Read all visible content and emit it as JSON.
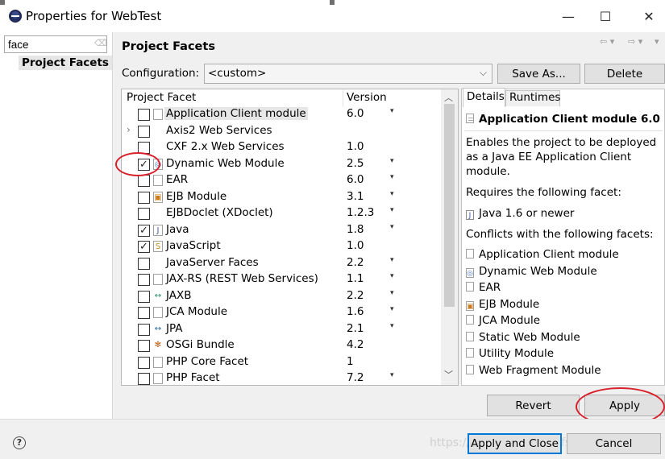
{
  "window": {
    "title": "Properties for WebTest",
    "minimize_glyph": "—",
    "maximize_glyph": "☐",
    "close_glyph": "✕"
  },
  "left_pane": {
    "filter_value": "face",
    "tree_item": "Project Facets"
  },
  "page": {
    "title": "Project Facets",
    "configuration_label": "Configuration:",
    "configuration_value": "<custom>",
    "save_as_label": "Save As...",
    "delete_label": "Delete"
  },
  "facets_table": {
    "col_facet": "Project Facet",
    "col_version": "Version",
    "rows": [
      {
        "name": "Application Client module",
        "version": "6.0",
        "checked": false,
        "icon": "page-icon",
        "has_dropdown": true,
        "expandable": false,
        "selected": true
      },
      {
        "name": "Axis2 Web Services",
        "version": "",
        "checked": false,
        "icon": "",
        "has_dropdown": false,
        "expandable": true,
        "selected": false
      },
      {
        "name": "CXF 2.x Web Services",
        "version": "1.0",
        "checked": false,
        "icon": "",
        "has_dropdown": false,
        "expandable": false,
        "selected": false
      },
      {
        "name": "Dynamic Web Module",
        "version": "2.5",
        "checked": true,
        "icon": "web-module-icon",
        "has_dropdown": true,
        "expandable": false,
        "selected": false
      },
      {
        "name": "EAR",
        "version": "6.0",
        "checked": false,
        "icon": "page-icon",
        "has_dropdown": true,
        "expandable": false,
        "selected": false
      },
      {
        "name": "EJB Module",
        "version": "3.1",
        "checked": false,
        "icon": "ejb-icon",
        "has_dropdown": true,
        "expandable": false,
        "selected": false
      },
      {
        "name": "EJBDoclet (XDoclet)",
        "version": "1.2.3",
        "checked": false,
        "icon": "",
        "has_dropdown": true,
        "expandable": false,
        "selected": false
      },
      {
        "name": "Java",
        "version": "1.8",
        "checked": true,
        "icon": "java-icon",
        "has_dropdown": true,
        "expandable": false,
        "selected": false
      },
      {
        "name": "JavaScript",
        "version": "1.0",
        "checked": true,
        "icon": "javascript-icon",
        "has_dropdown": false,
        "expandable": false,
        "selected": false
      },
      {
        "name": "JavaServer Faces",
        "version": "2.2",
        "checked": false,
        "icon": "",
        "has_dropdown": true,
        "expandable": false,
        "selected": false
      },
      {
        "name": "JAX-RS (REST Web Services)",
        "version": "1.1",
        "checked": false,
        "icon": "page-icon",
        "has_dropdown": true,
        "expandable": false,
        "selected": false
      },
      {
        "name": "JAXB",
        "version": "2.2",
        "checked": false,
        "icon": "jaxb-icon",
        "has_dropdown": true,
        "expandable": false,
        "selected": false
      },
      {
        "name": "JCA Module",
        "version": "1.6",
        "checked": false,
        "icon": "page-icon",
        "has_dropdown": true,
        "expandable": false,
        "selected": false
      },
      {
        "name": "JPA",
        "version": "2.1",
        "checked": false,
        "icon": "jpa-icon",
        "has_dropdown": true,
        "expandable": false,
        "selected": false
      },
      {
        "name": "OSGi Bundle",
        "version": "4.2",
        "checked": false,
        "icon": "osgi-icon",
        "has_dropdown": false,
        "expandable": false,
        "selected": false
      },
      {
        "name": "PHP Core Facet",
        "version": "1",
        "checked": false,
        "icon": "page-icon",
        "has_dropdown": false,
        "expandable": false,
        "selected": false
      },
      {
        "name": "PHP Facet",
        "version": "7.2",
        "checked": false,
        "icon": "page-icon",
        "has_dropdown": true,
        "expandable": false,
        "selected": false
      }
    ]
  },
  "details": {
    "tab_details": "Details",
    "tab_runtimes": "Runtimes",
    "title": "Application Client module 6.0",
    "description": "Enables the project to be deployed as a Java EE Application Client module.",
    "requires_label": "Requires the following facet:",
    "requires_item": "Java 1.6 or newer",
    "conflicts_label": "Conflicts with the following facets:",
    "conflicts": [
      {
        "name": "Application Client module",
        "icon": "page-icon"
      },
      {
        "name": "Dynamic Web Module",
        "icon": "web-module-icon"
      },
      {
        "name": "EAR",
        "icon": "page-icon"
      },
      {
        "name": "EJB Module",
        "icon": "ejb-icon"
      },
      {
        "name": "JCA Module",
        "icon": "page-icon"
      },
      {
        "name": "Static Web Module",
        "icon": "page-icon"
      },
      {
        "name": "Utility Module",
        "icon": "page-icon"
      },
      {
        "name": "Web Fragment Module",
        "icon": "page-icon"
      }
    ]
  },
  "buttons": {
    "revert": "Revert",
    "apply": "Apply",
    "apply_and_close": "Apply and Close",
    "cancel": "Cancel"
  },
  "watermark": "https://blog.csdn.net/...fst",
  "colors": {
    "annotation_red": "#d8202a",
    "selection_gray": "#e6e6e6",
    "button_face": "#e1e1e1",
    "default_button_border": "#0078d7"
  }
}
